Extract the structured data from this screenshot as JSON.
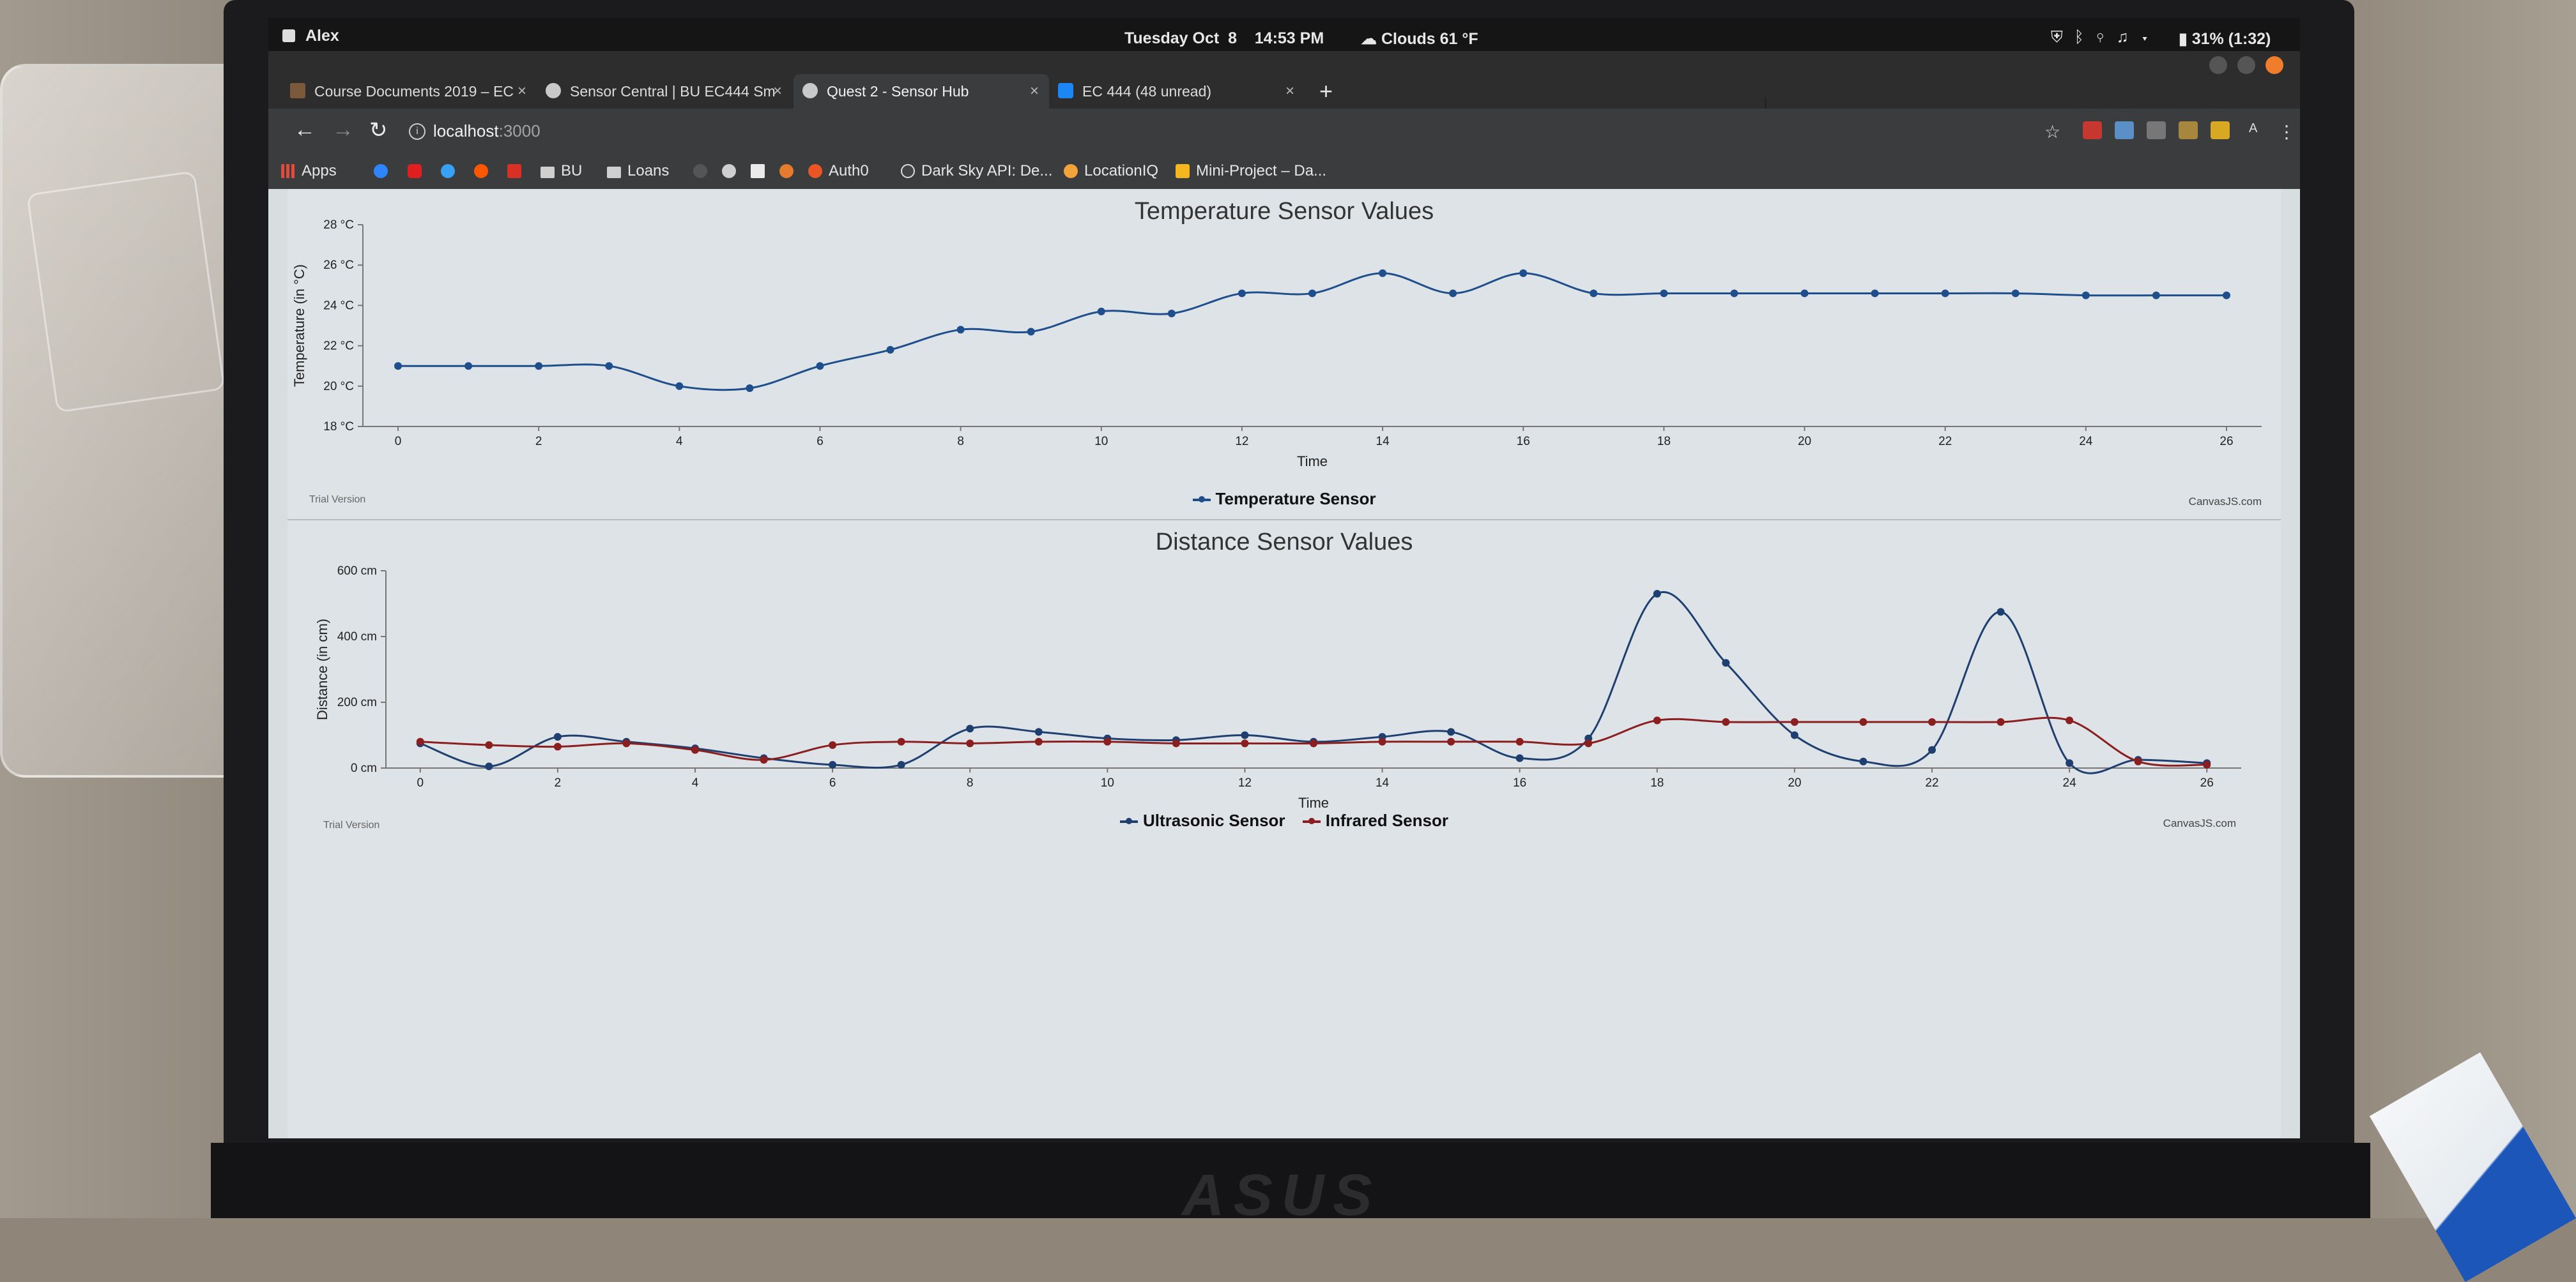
{
  "system_bar": {
    "user": "Alex",
    "datetime": "Tuesday Oct  8    14:53 PM",
    "weather": "Clouds 61 °F",
    "battery": "31% (1:32)",
    "tray_icons": [
      "shield-icon",
      "bluetooth-icon",
      "location-icon",
      "music-icon",
      "wifi-icon",
      "battery-icon"
    ]
  },
  "tabs": [
    {
      "label": "Course Documents 2019 – EC",
      "active": false
    },
    {
      "label": "Sensor Central | BU EC444 Sm",
      "active": false
    },
    {
      "label": "Quest 2 - Sensor Hub",
      "active": true
    },
    {
      "label": "EC 444 (48 unread)",
      "active": false
    }
  ],
  "toolbar": {
    "url_host": "localhost",
    "url_port": ":3000"
  },
  "bookmarks": [
    "Apps",
    "BU",
    "Loans",
    "Auth0",
    "Dark Sky API: De...",
    "LocationIQ",
    "Mini-Project – Da..."
  ],
  "temperature_chart": {
    "title": "Temperature Sensor Values",
    "trial_label": "Trial Version",
    "credit": "CanvasJS.com"
  },
  "distance_chart": {
    "title": "Distance Sensor Values",
    "trial_label": "Trial Version",
    "credit": "CanvasJS.com"
  },
  "chart_data": [
    {
      "type": "line",
      "title": "Temperature Sensor Values",
      "xlabel": "Time",
      "ylabel": "Temperature (in °C)",
      "ylim": [
        18,
        28
      ],
      "xlim": [
        -0.5,
        26.5
      ],
      "x_ticks": [
        0,
        2,
        4,
        6,
        8,
        10,
        12,
        14,
        16,
        18,
        20,
        22,
        24,
        26
      ],
      "y_tick_labels": [
        "18 °C",
        "20 °C",
        "22 °C",
        "24 °C",
        "26 °C",
        "28 °C"
      ],
      "y_ticks": [
        18,
        20,
        22,
        24,
        26,
        28
      ],
      "legend_position": "bottom-center",
      "series": [
        {
          "name": "Temperature Sensor",
          "color": "#1f4e8c",
          "x": [
            0,
            1,
            2,
            3,
            4,
            5,
            6,
            7,
            8,
            9,
            10,
            11,
            12,
            13,
            14,
            15,
            16,
            17,
            18,
            19,
            20,
            21,
            22,
            23,
            24,
            25,
            26
          ],
          "values": [
            21,
            21,
            21,
            21,
            20,
            19.9,
            21,
            21.8,
            22.8,
            22.7,
            23.7,
            23.6,
            24.6,
            24.6,
            25.6,
            24.6,
            25.6,
            24.6,
            24.6,
            24.6,
            24.6,
            24.6,
            24.6,
            24.6,
            24.5,
            24.5,
            24.5
          ]
        }
      ]
    },
    {
      "type": "line",
      "title": "Distance Sensor Values",
      "xlabel": "Time",
      "ylabel": "Distance (in cm)",
      "ylim": [
        0,
        600
      ],
      "xlim": [
        -0.5,
        26.5
      ],
      "x_ticks": [
        0,
        2,
        4,
        6,
        8,
        10,
        12,
        14,
        16,
        18,
        20,
        22,
        24,
        26
      ],
      "y_tick_labels": [
        "0 cm",
        "200 cm",
        "400 cm",
        "600 cm"
      ],
      "y_ticks": [
        0,
        200,
        400,
        600
      ],
      "legend_position": "bottom-center",
      "series": [
        {
          "name": "Ultrasonic Sensor",
          "color": "#1f3f70",
          "x": [
            0,
            1,
            2,
            3,
            4,
            5,
            6,
            7,
            8,
            9,
            10,
            11,
            12,
            13,
            14,
            15,
            16,
            17,
            18,
            19,
            20,
            21,
            22,
            23,
            24,
            25,
            26
          ],
          "values": [
            75,
            5,
            95,
            80,
            60,
            30,
            10,
            10,
            120,
            110,
            90,
            85,
            100,
            80,
            95,
            110,
            30,
            90,
            530,
            320,
            100,
            20,
            55,
            475,
            15,
            25,
            15
          ]
        },
        {
          "name": "Infrared Sensor",
          "color": "#8b1e1e",
          "x": [
            0,
            1,
            2,
            3,
            4,
            5,
            6,
            7,
            8,
            9,
            10,
            11,
            12,
            13,
            14,
            15,
            16,
            17,
            18,
            19,
            20,
            21,
            22,
            23,
            24,
            25,
            26
          ],
          "values": [
            80,
            70,
            65,
            75,
            55,
            25,
            70,
            80,
            75,
            80,
            80,
            75,
            75,
            75,
            80,
            80,
            80,
            75,
            145,
            140,
            140,
            140,
            140,
            140,
            145,
            20,
            10
          ]
        }
      ]
    }
  ]
}
